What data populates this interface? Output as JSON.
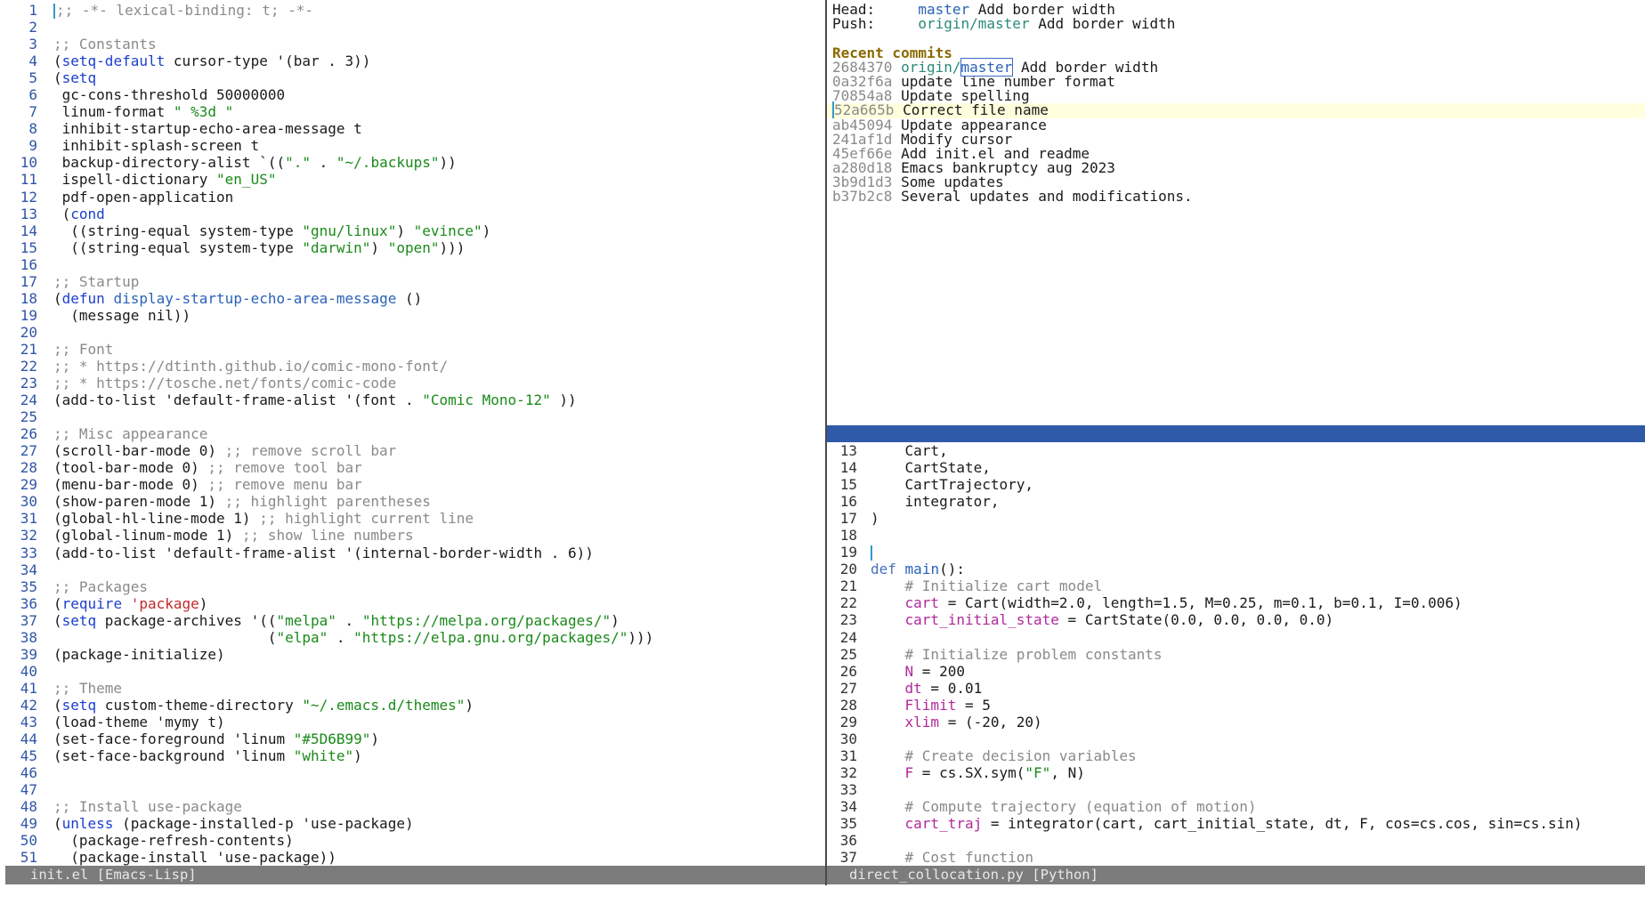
{
  "left_buffer": {
    "modeline": "init.el [Emacs-Lisp]",
    "lines": [
      {
        "n": "1",
        "parts": [
          {
            "t": ";; -*- lexical-binding: t; -*-",
            "c": "c"
          }
        ],
        "cursor": true
      },
      {
        "n": "2",
        "parts": []
      },
      {
        "n": "3",
        "parts": [
          {
            "t": ";; Constants",
            "c": "c"
          }
        ]
      },
      {
        "n": "4",
        "parts": [
          {
            "t": "(",
            "c": ""
          },
          {
            "t": "setq-default",
            "c": "k"
          },
          {
            "t": " cursor-type '(bar . 3))",
            "c": ""
          }
        ]
      },
      {
        "n": "5",
        "parts": [
          {
            "t": "(",
            "c": ""
          },
          {
            "t": "setq",
            "c": "k"
          }
        ]
      },
      {
        "n": "6",
        "parts": [
          {
            "t": " gc-cons-threshold 50000000",
            "c": ""
          }
        ]
      },
      {
        "n": "7",
        "parts": [
          {
            "t": " linum-format ",
            "c": ""
          },
          {
            "t": "\" %3d \"",
            "c": "s"
          }
        ]
      },
      {
        "n": "8",
        "parts": [
          {
            "t": " inhibit-startup-echo-area-message t",
            "c": ""
          }
        ]
      },
      {
        "n": "9",
        "parts": [
          {
            "t": " inhibit-splash-screen t",
            "c": ""
          }
        ]
      },
      {
        "n": "10",
        "parts": [
          {
            "t": " backup-directory-alist `((",
            "c": ""
          },
          {
            "t": "\".\"",
            "c": "s"
          },
          {
            "t": " . ",
            "c": ""
          },
          {
            "t": "\"~/.backups\"",
            "c": "s"
          },
          {
            "t": "))",
            "c": ""
          }
        ]
      },
      {
        "n": "11",
        "parts": [
          {
            "t": " ispell-dictionary ",
            "c": ""
          },
          {
            "t": "\"en_US\"",
            "c": "s"
          }
        ]
      },
      {
        "n": "12",
        "parts": [
          {
            "t": " pdf-open-application",
            "c": ""
          }
        ]
      },
      {
        "n": "13",
        "parts": [
          {
            "t": " (",
            "c": ""
          },
          {
            "t": "cond",
            "c": "k"
          }
        ]
      },
      {
        "n": "14",
        "parts": [
          {
            "t": "  ((string-equal system-type ",
            "c": ""
          },
          {
            "t": "\"gnu/linux\"",
            "c": "s"
          },
          {
            "t": ") ",
            "c": ""
          },
          {
            "t": "\"evince\"",
            "c": "s"
          },
          {
            "t": ")",
            "c": ""
          }
        ]
      },
      {
        "n": "15",
        "parts": [
          {
            "t": "  ((string-equal system-type ",
            "c": ""
          },
          {
            "t": "\"darwin\"",
            "c": "s"
          },
          {
            "t": ") ",
            "c": ""
          },
          {
            "t": "\"open\"",
            "c": "s"
          },
          {
            "t": ")))",
            "c": ""
          }
        ]
      },
      {
        "n": "16",
        "parts": []
      },
      {
        "n": "17",
        "parts": [
          {
            "t": ";; Startup",
            "c": "c"
          }
        ]
      },
      {
        "n": "18",
        "parts": [
          {
            "t": "(",
            "c": ""
          },
          {
            "t": "defun",
            "c": "k"
          },
          {
            "t": " ",
            "c": ""
          },
          {
            "t": "display-startup-echo-area-message",
            "c": "f"
          },
          {
            "t": " ()",
            "c": ""
          }
        ]
      },
      {
        "n": "19",
        "parts": [
          {
            "t": "  (message nil))",
            "c": ""
          }
        ]
      },
      {
        "n": "20",
        "parts": []
      },
      {
        "n": "21",
        "parts": [
          {
            "t": ";; Font",
            "c": "c"
          }
        ]
      },
      {
        "n": "22",
        "parts": [
          {
            "t": ";; * https://dtinth.github.io/comic-mono-font/",
            "c": "c"
          }
        ]
      },
      {
        "n": "23",
        "parts": [
          {
            "t": ";; * https://tosche.net/fonts/comic-code",
            "c": "c"
          }
        ]
      },
      {
        "n": "24",
        "parts": [
          {
            "t": "(add-to-list 'default-frame-alist '(font . ",
            "c": ""
          },
          {
            "t": "\"Comic Mono-12\"",
            "c": "s"
          },
          {
            "t": " ))",
            "c": ""
          }
        ]
      },
      {
        "n": "25",
        "parts": []
      },
      {
        "n": "26",
        "parts": [
          {
            "t": ";; Misc appearance",
            "c": "c"
          }
        ]
      },
      {
        "n": "27",
        "parts": [
          {
            "t": "(scroll-bar-mode 0) ",
            "c": ""
          },
          {
            "t": ";; remove scroll bar",
            "c": "c"
          }
        ]
      },
      {
        "n": "28",
        "parts": [
          {
            "t": "(tool-bar-mode 0) ",
            "c": ""
          },
          {
            "t": ";; remove tool bar",
            "c": "c"
          }
        ]
      },
      {
        "n": "29",
        "parts": [
          {
            "t": "(menu-bar-mode 0) ",
            "c": ""
          },
          {
            "t": ";; remove menu bar",
            "c": "c"
          }
        ]
      },
      {
        "n": "30",
        "parts": [
          {
            "t": "(show-paren-mode 1) ",
            "c": ""
          },
          {
            "t": ";; highlight parentheses",
            "c": "c"
          }
        ]
      },
      {
        "n": "31",
        "parts": [
          {
            "t": "(global-hl-line-mode 1) ",
            "c": ""
          },
          {
            "t": ";; highlight current line",
            "c": "c"
          }
        ]
      },
      {
        "n": "32",
        "parts": [
          {
            "t": "(global-linum-mode 1) ",
            "c": ""
          },
          {
            "t": ";; show line numbers",
            "c": "c"
          }
        ]
      },
      {
        "n": "33",
        "parts": [
          {
            "t": "(add-to-list 'default-frame-alist '(internal-border-width . 6))",
            "c": ""
          }
        ]
      },
      {
        "n": "34",
        "parts": []
      },
      {
        "n": "35",
        "parts": [
          {
            "t": ";; Packages",
            "c": "c"
          }
        ]
      },
      {
        "n": "36",
        "parts": [
          {
            "t": "(",
            "c": ""
          },
          {
            "t": "require",
            "c": "k"
          },
          {
            "t": " ",
            "c": ""
          },
          {
            "t": "'package",
            "c": "r"
          },
          {
            "t": ")",
            "c": ""
          }
        ]
      },
      {
        "n": "37",
        "parts": [
          {
            "t": "(",
            "c": ""
          },
          {
            "t": "setq",
            "c": "k"
          },
          {
            "t": " package-archives '((",
            "c": ""
          },
          {
            "t": "\"melpa\"",
            "c": "s"
          },
          {
            "t": " . ",
            "c": ""
          },
          {
            "t": "\"https://melpa.org/packages/\"",
            "c": "s"
          },
          {
            "t": ")",
            "c": ""
          }
        ]
      },
      {
        "n": "38",
        "parts": [
          {
            "t": "                         (",
            "c": ""
          },
          {
            "t": "\"elpa\"",
            "c": "s"
          },
          {
            "t": " . ",
            "c": ""
          },
          {
            "t": "\"https://elpa.gnu.org/packages/\"",
            "c": "s"
          },
          {
            "t": ")))",
            "c": ""
          }
        ]
      },
      {
        "n": "39",
        "parts": [
          {
            "t": "(package-initialize)",
            "c": ""
          }
        ]
      },
      {
        "n": "40",
        "parts": []
      },
      {
        "n": "41",
        "parts": [
          {
            "t": ";; Theme",
            "c": "c"
          }
        ]
      },
      {
        "n": "42",
        "parts": [
          {
            "t": "(",
            "c": ""
          },
          {
            "t": "setq",
            "c": "k"
          },
          {
            "t": " custom-theme-directory ",
            "c": ""
          },
          {
            "t": "\"~/.emacs.d/themes\"",
            "c": "s"
          },
          {
            "t": ")",
            "c": ""
          }
        ]
      },
      {
        "n": "43",
        "parts": [
          {
            "t": "(load-theme 'mymy t)",
            "c": ""
          }
        ]
      },
      {
        "n": "44",
        "parts": [
          {
            "t": "(set-face-foreground 'linum ",
            "c": ""
          },
          {
            "t": "\"#5D6B99\"",
            "c": "s"
          },
          {
            "t": ")",
            "c": ""
          }
        ]
      },
      {
        "n": "45",
        "parts": [
          {
            "t": "(set-face-background 'linum ",
            "c": ""
          },
          {
            "t": "\"white\"",
            "c": "s"
          },
          {
            "t": ")",
            "c": ""
          }
        ]
      },
      {
        "n": "46",
        "parts": []
      },
      {
        "n": "47",
        "parts": []
      },
      {
        "n": "48",
        "parts": [
          {
            "t": ";; Install use-package",
            "c": "c"
          }
        ]
      },
      {
        "n": "49",
        "parts": [
          {
            "t": "(",
            "c": ""
          },
          {
            "t": "unless",
            "c": "k"
          },
          {
            "t": " (package-installed-p 'use-package)",
            "c": ""
          }
        ]
      },
      {
        "n": "50",
        "parts": [
          {
            "t": "  (package-refresh-contents)",
            "c": ""
          }
        ]
      },
      {
        "n": "51",
        "parts": [
          {
            "t": "  (package-install 'use-package))",
            "c": ""
          }
        ]
      }
    ]
  },
  "magit": {
    "head_label": "Head:",
    "head_branch": "master",
    "head_msg": "Add border width",
    "push_label": "Push:",
    "push_branch": "origin/master",
    "push_msg": "Add border width",
    "section_title": "Recent commits",
    "commits": [
      {
        "hash": "2684370",
        "refs_prefix": "origin/",
        "refs_boxed": "master",
        "msg": "Add border width"
      },
      {
        "hash": "0a32f6a",
        "msg": "update line number format"
      },
      {
        "hash": "70854a8",
        "msg": "Update spelling"
      },
      {
        "hash": "52a665b",
        "msg": "Correct file name",
        "current": true
      },
      {
        "hash": "ab45094",
        "msg": "Update appearance"
      },
      {
        "hash": "241af1d",
        "msg": "Modify cursor"
      },
      {
        "hash": "45ef66e",
        "msg": "Add init.el and readme"
      },
      {
        "hash": "a280d18",
        "msg": "Emacs bankruptcy aug 2023"
      },
      {
        "hash": "3b9d1d3",
        "msg": "Some updates"
      },
      {
        "hash": "b37b2c8",
        "msg": "Several updates and modifications."
      }
    ]
  },
  "right_buffer": {
    "modeline": "direct_collocation.py [Python]",
    "lines": [
      {
        "n": "13",
        "parts": [
          {
            "t": "    Cart,",
            "c": ""
          }
        ]
      },
      {
        "n": "14",
        "parts": [
          {
            "t": "    CartState,",
            "c": ""
          }
        ]
      },
      {
        "n": "15",
        "parts": [
          {
            "t": "    CartTrajectory,",
            "c": ""
          }
        ]
      },
      {
        "n": "16",
        "parts": [
          {
            "t": "    integrator,",
            "c": ""
          }
        ]
      },
      {
        "n": "17",
        "parts": [
          {
            "t": ")",
            "c": ""
          }
        ]
      },
      {
        "n": "18",
        "parts": []
      },
      {
        "n": "19",
        "parts": [],
        "cursor": true
      },
      {
        "n": "20",
        "parts": [
          {
            "t": "def",
            "c": "d"
          },
          {
            "t": " ",
            "c": ""
          },
          {
            "t": "main",
            "c": "f"
          },
          {
            "t": "():",
            "c": ""
          }
        ]
      },
      {
        "n": "21",
        "parts": [
          {
            "t": "    # Initialize cart model",
            "c": "c"
          }
        ]
      },
      {
        "n": "22",
        "parts": [
          {
            "t": "    ",
            "c": ""
          },
          {
            "t": "cart",
            "c": "v"
          },
          {
            "t": " = Cart(width=2.0, length=1.5, M=0.25, m=0.1, b=0.1, I=0.006)",
            "c": ""
          }
        ]
      },
      {
        "n": "23",
        "parts": [
          {
            "t": "    ",
            "c": ""
          },
          {
            "t": "cart_initial_state",
            "c": "v"
          },
          {
            "t": " = CartState(0.0, 0.0, 0.0, 0.0)",
            "c": ""
          }
        ]
      },
      {
        "n": "24",
        "parts": []
      },
      {
        "n": "25",
        "parts": [
          {
            "t": "    # Initialize problem constants",
            "c": "c"
          }
        ]
      },
      {
        "n": "26",
        "parts": [
          {
            "t": "    ",
            "c": ""
          },
          {
            "t": "N",
            "c": "v"
          },
          {
            "t": " = 200",
            "c": ""
          }
        ]
      },
      {
        "n": "27",
        "parts": [
          {
            "t": "    ",
            "c": ""
          },
          {
            "t": "dt",
            "c": "v"
          },
          {
            "t": " = 0.01",
            "c": ""
          }
        ]
      },
      {
        "n": "28",
        "parts": [
          {
            "t": "    ",
            "c": ""
          },
          {
            "t": "Flimit",
            "c": "v"
          },
          {
            "t": " = 5",
            "c": ""
          }
        ]
      },
      {
        "n": "29",
        "parts": [
          {
            "t": "    ",
            "c": ""
          },
          {
            "t": "xlim",
            "c": "v"
          },
          {
            "t": " = (-20, 20)",
            "c": ""
          }
        ]
      },
      {
        "n": "30",
        "parts": []
      },
      {
        "n": "31",
        "parts": [
          {
            "t": "    # Create decision variables",
            "c": "c"
          }
        ]
      },
      {
        "n": "32",
        "parts": [
          {
            "t": "    ",
            "c": ""
          },
          {
            "t": "F",
            "c": "v"
          },
          {
            "t": " = cs.SX.sym(",
            "c": ""
          },
          {
            "t": "\"F\"",
            "c": "s"
          },
          {
            "t": ", N)",
            "c": ""
          }
        ]
      },
      {
        "n": "33",
        "parts": []
      },
      {
        "n": "34",
        "parts": [
          {
            "t": "    # Compute trajectory (equation of motion)",
            "c": "c"
          }
        ]
      },
      {
        "n": "35",
        "parts": [
          {
            "t": "    ",
            "c": ""
          },
          {
            "t": "cart_traj",
            "c": "v"
          },
          {
            "t": " = integrator(cart, cart_initial_state, dt, F, cos=cs.cos, sin=cs.sin)",
            "c": ""
          }
        ]
      },
      {
        "n": "36",
        "parts": []
      },
      {
        "n": "37",
        "parts": [
          {
            "t": "    # Cost function",
            "c": "c"
          }
        ]
      }
    ]
  }
}
